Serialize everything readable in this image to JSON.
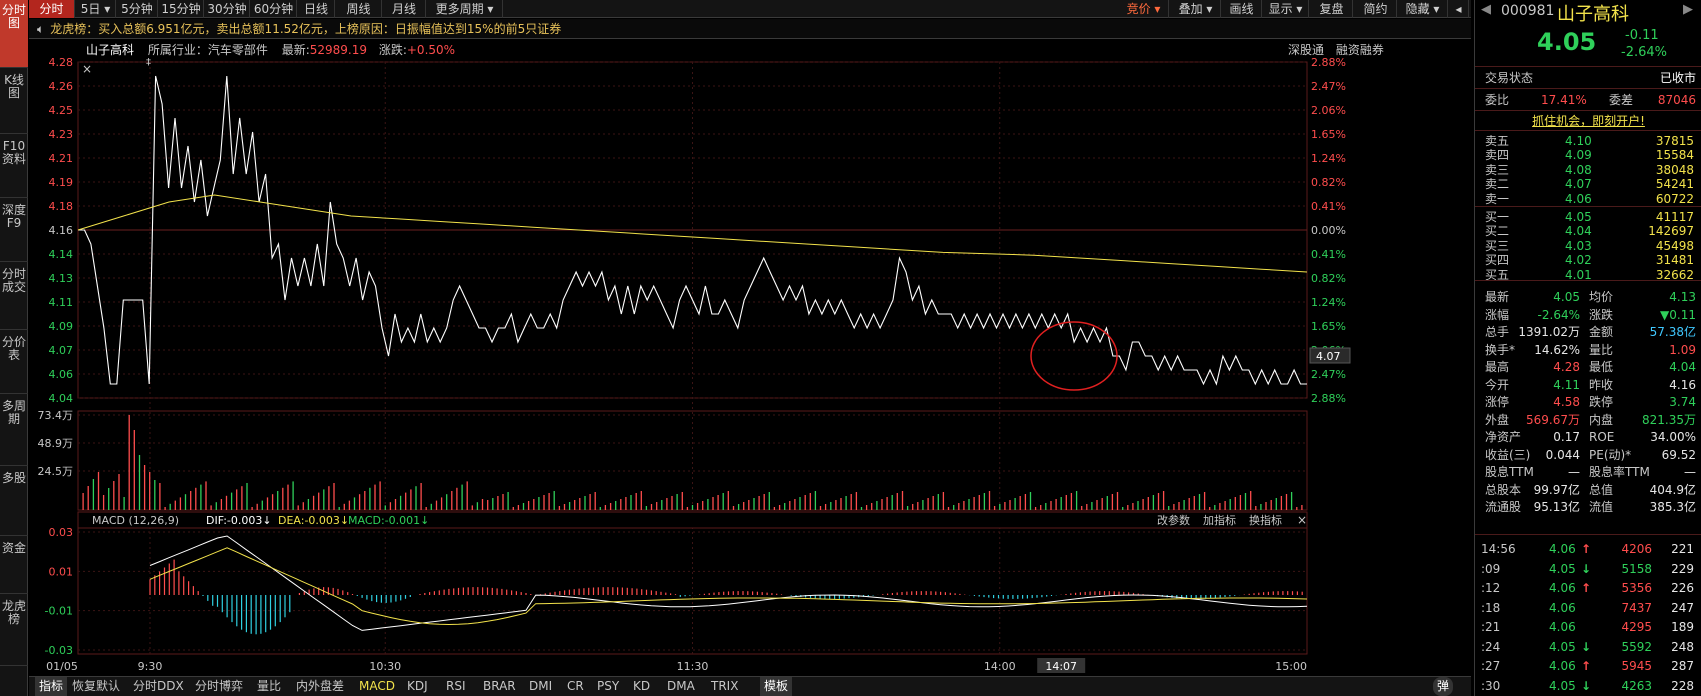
{
  "left_tabs": [
    "分时图",
    "K线图",
    "F10资料",
    "深度F9",
    "分时成交",
    "分价表",
    "多周期",
    "多股",
    "资金",
    "龙虎榜"
  ],
  "toolbar": {
    "left": [
      "分时",
      "5日 ▾",
      "5分钟",
      "15分钟",
      "30分钟",
      "60分钟",
      "日线",
      "周线",
      "月线",
      "更多周期 ▾"
    ],
    "right": [
      "竞价 ▾",
      "叠加 ▾",
      "画线",
      "显示 ▾",
      "复盘",
      "简约",
      "隐藏 ▾"
    ]
  },
  "infobar": "龙虎榜：买入总额6.951亿元，卖出总额11.52亿元，上榜原因：日振幅值达到15%的前5只证券",
  "chart_head": {
    "name": "山子高科",
    "industry_label": "所属行业：汽车零部件",
    "latest_label": "最新:",
    "latest_value": "52989.19",
    "change_label": "涨跌:",
    "change_value": "+0.50%",
    "right_links": [
      "深股通",
      "融资融券"
    ]
  },
  "price_axis_left": [
    "4.28",
    "4.26",
    "4.25",
    "4.23",
    "4.21",
    "4.19",
    "4.18",
    "4.16",
    "4.14",
    "4.13",
    "4.11",
    "4.09",
    "4.07",
    "4.06",
    "4.04"
  ],
  "pct_axis_right": [
    "2.88%",
    "2.47%",
    "2.06%",
    "1.65%",
    "1.24%",
    "0.82%",
    "0.41%",
    "0.00%",
    "0.41%",
    "0.82%",
    "1.24%",
    "1.65%",
    "2.06%",
    "2.47%",
    "2.88%"
  ],
  "current_price_tag": "4.07",
  "volume_axis": [
    "73.4万",
    "48.9万",
    "24.5万"
  ],
  "macd_head": {
    "label": "MACD (12,26,9)",
    "dif": "DIF:-0.003↓",
    "dea": "DEA:-0.003↓",
    "macd": "MACD:-0.001↓",
    "actions": [
      "改参数",
      "加指标",
      "换指标"
    ]
  },
  "macd_axis": [
    "0.03",
    "0.01",
    "-0.01",
    "-0.03"
  ],
  "time_axis": [
    "01/05",
    "9:30",
    "10:30",
    "11:30",
    "14:00",
    "14:07",
    "15:00"
  ],
  "bottom_tabs": [
    "指标",
    "恢复默认",
    "分时DDX",
    "分时博弈",
    "量比",
    "内外盘差",
    "MACD",
    "KDJ",
    "RSI",
    "BRAR",
    "DMI",
    "CR",
    "PSY",
    "KD",
    "DMA",
    "TRIX",
    "模板"
  ],
  "bottom_right": "弹",
  "colors": {
    "up": "#ff4d4d",
    "down": "#2fd05a",
    "price_line": "#ffffff",
    "avg_line": "#f2e24b",
    "macd_pos": "#ff4d4d",
    "macd_neg": "#2fd0e0",
    "annotation_circle": "#e02020"
  },
  "quote": {
    "code": "000981",
    "name": "山子高科",
    "price": "4.05",
    "change": "-0.11",
    "change_pct": "-2.64%",
    "status_label": "交易状态",
    "status_value": "已收市",
    "weibi_label": "委比",
    "weibi_value": "17.41%",
    "weicha_label": "委差",
    "weicha_value": "87046",
    "promo": "抓住机会，即刻开户!",
    "asks": [
      {
        "label": "卖五",
        "price": "4.10",
        "vol": "37815"
      },
      {
        "label": "卖四",
        "price": "4.09",
        "vol": "15584"
      },
      {
        "label": "卖三",
        "price": "4.08",
        "vol": "38048"
      },
      {
        "label": "卖二",
        "price": "4.07",
        "vol": "54241"
      },
      {
        "label": "卖一",
        "price": "4.06",
        "vol": "60722"
      }
    ],
    "bids": [
      {
        "label": "买一",
        "price": "4.05",
        "vol": "41117"
      },
      {
        "label": "买二",
        "price": "4.04",
        "vol": "142697"
      },
      {
        "label": "买三",
        "price": "4.03",
        "vol": "45498"
      },
      {
        "label": "买四",
        "price": "4.02",
        "vol": "31481"
      },
      {
        "label": "买五",
        "price": "4.01",
        "vol": "32662"
      }
    ],
    "stats": [
      {
        "l1": "最新",
        "v1": "4.05",
        "c1": "green",
        "l2": "均价",
        "v2": "4.13",
        "c2": "green"
      },
      {
        "l1": "涨幅",
        "v1": "-2.64%",
        "c1": "green",
        "l2": "涨跌",
        "v2": "▼0.11",
        "c2": "green"
      },
      {
        "l1": "总手",
        "v1": "1391.02万",
        "c1": "white",
        "l2": "金额",
        "v2": "57.38亿",
        "c2": "cyan"
      },
      {
        "l1": "换手*",
        "v1": "14.62%",
        "c1": "white",
        "l2": "量比",
        "v2": "1.09",
        "c2": "red"
      },
      {
        "l1": "最高",
        "v1": "4.28",
        "c1": "red",
        "l2": "最低",
        "v2": "4.04",
        "c2": "green"
      },
      {
        "l1": "今开",
        "v1": "4.11",
        "c1": "green",
        "l2": "昨收",
        "v2": "4.16",
        "c2": "white"
      },
      {
        "l1": "涨停",
        "v1": "4.58",
        "c1": "red",
        "l2": "跌停",
        "v2": "3.74",
        "c2": "green"
      },
      {
        "l1": "外盘",
        "v1": "569.67万",
        "c1": "red",
        "l2": "内盘",
        "v2": "821.35万",
        "c2": "green"
      },
      {
        "l1": "净资产",
        "v1": "0.17",
        "c1": "white",
        "l2": "ROE",
        "v2": "34.00%",
        "c2": "white"
      },
      {
        "l1": "收益(三)",
        "v1": "0.044",
        "c1": "white",
        "l2": "PE(动)*",
        "v2": "69.52",
        "c2": "white"
      },
      {
        "l1": "股息TTM",
        "v1": "—",
        "c1": "white",
        "l2": "股息率TTM",
        "v2": "—",
        "c2": "white"
      },
      {
        "l1": "总股本",
        "v1": "99.97亿",
        "c1": "white",
        "l2": "总值",
        "v2": "404.9亿",
        "c2": "white"
      },
      {
        "l1": "流通股",
        "v1": "95.13亿",
        "c1": "white",
        "l2": "流值",
        "v2": "385.3亿",
        "c2": "white"
      }
    ],
    "trades": [
      {
        "time": "14:56",
        "price": "4.06",
        "arrow": "↑",
        "vol": "4206",
        "n": "221"
      },
      {
        "time": ":09",
        "price": "4.05",
        "arrow": "↓",
        "vol": "5158",
        "n": "229"
      },
      {
        "time": ":12",
        "price": "4.06",
        "arrow": "↑",
        "vol": "5356",
        "n": "226"
      },
      {
        "time": ":18",
        "price": "4.06",
        "arrow": "",
        "vol": "7437",
        "n": "247"
      },
      {
        "time": ":21",
        "price": "4.06",
        "arrow": "",
        "vol": "4295",
        "n": "189"
      },
      {
        "time": ":24",
        "price": "4.05",
        "arrow": "↓",
        "vol": "5592",
        "n": "248"
      },
      {
        "time": ":27",
        "price": "4.06",
        "arrow": "↑",
        "vol": "5945",
        "n": "287"
      },
      {
        "time": ":30",
        "price": "4.05",
        "arrow": "↓",
        "vol": "4263",
        "n": "228"
      }
    ]
  },
  "chart_data": {
    "type": "line",
    "title": "山子高科",
    "prev_close": 4.16,
    "ylim": [
      4.04,
      4.28
    ],
    "x_ticks": [
      "9:30",
      "10:30",
      "11:30",
      "14:00",
      "15:00"
    ],
    "series": [
      {
        "values": [
          4.16,
          4.16,
          4.15,
          4.12,
          4.09,
          4.05,
          4.05,
          4.11,
          4.11,
          4.11,
          4.11,
          4.05,
          4.27,
          4.25,
          4.19,
          4.24,
          4.19,
          4.22,
          4.18,
          4.21,
          4.17,
          4.19,
          4.21,
          4.27,
          4.2,
          4.24,
          4.2,
          4.23,
          4.18,
          4.2,
          4.14,
          4.15,
          4.11,
          4.14,
          4.12,
          4.14,
          4.12,
          4.15,
          4.12,
          4.18,
          4.15,
          4.14,
          4.12,
          4.14,
          4.11,
          4.13,
          4.12,
          4.09,
          4.07,
          4.1,
          4.08,
          4.09,
          4.08,
          4.1,
          4.08,
          4.09,
          4.08,
          4.09,
          4.11,
          4.12,
          4.11,
          4.1,
          4.09,
          4.09,
          4.08,
          4.09,
          4.09,
          4.1,
          4.08,
          4.09,
          4.1,
          4.09,
          4.09,
          4.1,
          4.09,
          4.11,
          4.12,
          4.13,
          4.12,
          4.13,
          4.12,
          4.13,
          4.11,
          4.12,
          4.1,
          4.12,
          4.1,
          4.12,
          4.11,
          4.12,
          4.11,
          4.1,
          4.09,
          4.11,
          4.12,
          4.11,
          4.1,
          4.12,
          4.1,
          4.1,
          4.11,
          4.1,
          4.09,
          4.11,
          4.12,
          4.13,
          4.14,
          4.13,
          4.12,
          4.11,
          4.12,
          4.11,
          4.12,
          4.1,
          4.11,
          4.1,
          4.11,
          4.1,
          4.11,
          4.1,
          4.09,
          4.1,
          4.09,
          4.1,
          4.09,
          4.1,
          4.11,
          4.14,
          4.13,
          4.11,
          4.12,
          4.1,
          4.11,
          4.1,
          4.1,
          4.1,
          4.09,
          4.1,
          4.09,
          4.1,
          4.09,
          4.1,
          4.09,
          4.1,
          4.09,
          4.1,
          4.09,
          4.1,
          4.09,
          4.1,
          4.09,
          4.1,
          4.09,
          4.1,
          4.08,
          4.09,
          4.08,
          4.09,
          4.08,
          4.09,
          4.07,
          4.07,
          4.06,
          4.08,
          4.08,
          4.07,
          4.07,
          4.06,
          4.07,
          4.06,
          4.07,
          4.06,
          4.06,
          4.06,
          4.05,
          4.06,
          4.05,
          4.07,
          4.06,
          4.07,
          4.06,
          4.06,
          4.05,
          4.06,
          4.05,
          4.06,
          4.05,
          4.05,
          4.06,
          4.05,
          4.05
        ]
      },
      {
        "values": [
          4.16,
          4.17,
          4.18,
          4.185,
          4.18,
          4.175,
          4.17,
          4.168,
          4.166,
          4.164,
          4.162,
          4.16,
          4.158,
          4.156,
          4.154,
          4.152,
          4.15,
          4.148,
          4.146,
          4.144,
          4.143,
          4.142,
          4.14,
          4.138,
          4.136,
          4.134,
          4.132,
          4.13
        ]
      }
    ]
  }
}
